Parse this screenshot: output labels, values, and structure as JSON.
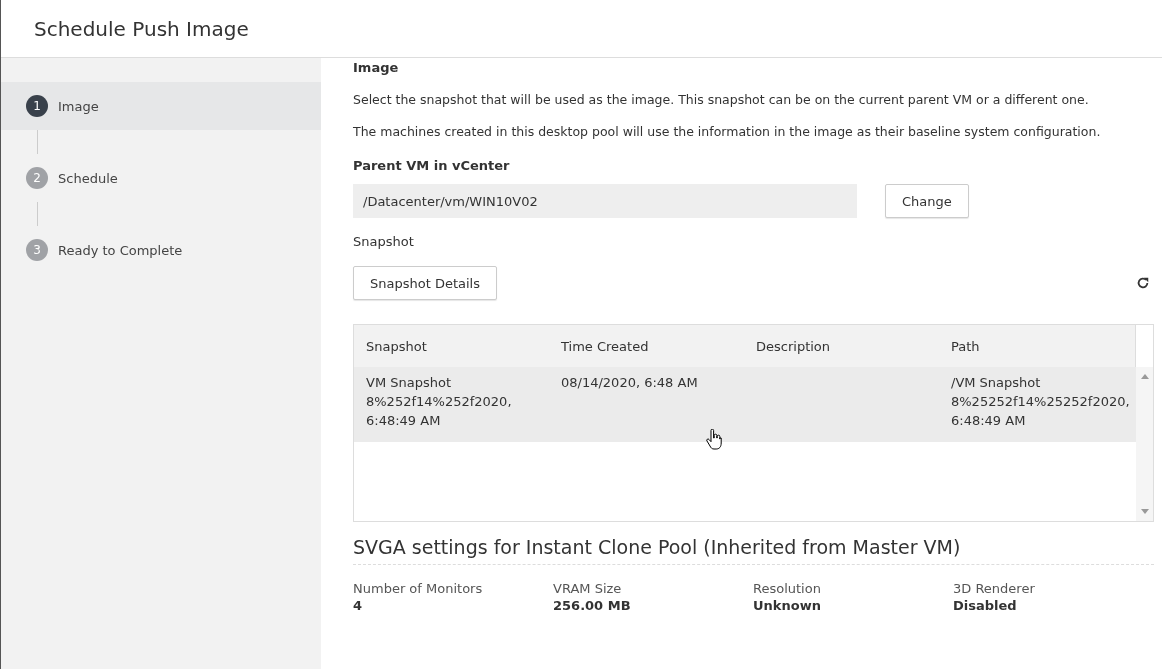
{
  "window": {
    "title": "Schedule Push Image"
  },
  "steps": [
    {
      "number": "1",
      "label": "Image",
      "selected": true
    },
    {
      "number": "2",
      "label": "Schedule",
      "selected": false
    },
    {
      "number": "3",
      "label": "Ready to Complete",
      "selected": false
    }
  ],
  "section_title": "Image",
  "descriptions": [
    "Select the snapshot that will be used as the image. This snapshot can be on the current parent VM or a different one.",
    "The machines created in this desktop pool will use the information in the image as their baseline system configuration."
  ],
  "parent_vm": {
    "label": "Parent VM in vCenter",
    "value": "/Datacenter/vm/WIN10V02",
    "button": "Change"
  },
  "snapshot_label": "Snapshot",
  "snapshot_details_button": "Snapshot Details",
  "table": {
    "columns": [
      "Snapshot",
      "Time Created",
      "Description",
      "Path"
    ],
    "rows": [
      {
        "selected": true,
        "cells": [
          "VM Snapshot 8%252f14%252f2020, 6:48:49 AM",
          "08/14/2020, 6:48 AM",
          "",
          "/VM Snapshot 8%25252f14%25252f2020, 6:48:49 AM"
        ]
      }
    ]
  },
  "svga": {
    "title": "SVGA settings for Instant Clone Pool (Inherited from Master VM)",
    "fields": [
      {
        "label": "Number of Monitors",
        "value": "4"
      },
      {
        "label": "VRAM Size",
        "value": "256.00 MB"
      },
      {
        "label": "Resolution",
        "value": "Unknown"
      },
      {
        "label": "3D Renderer",
        "value": "Disabled"
      }
    ]
  }
}
